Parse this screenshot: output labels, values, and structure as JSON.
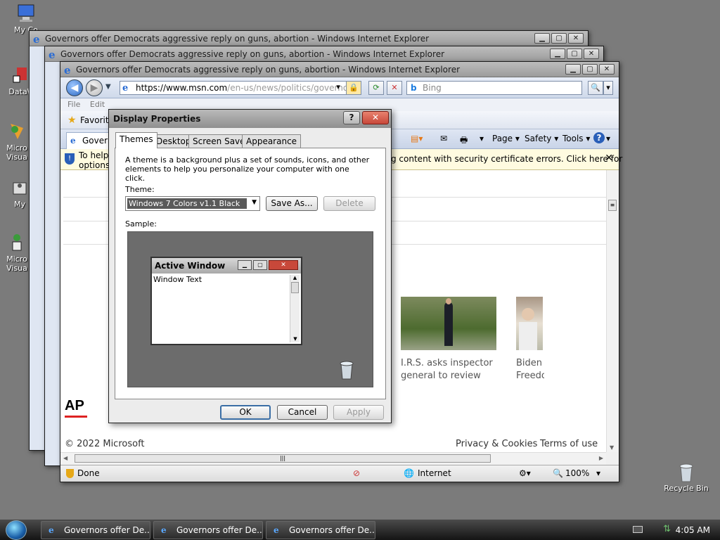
{
  "desktop": {
    "icons": [
      {
        "label": "My Co"
      },
      {
        "label": "DataW"
      },
      {
        "label": "Micro Visua"
      },
      {
        "label": "My"
      },
      {
        "label": "Micro Visua"
      }
    ],
    "recycle_bin": "Recycle Bin"
  },
  "ie": {
    "window_title": "Governors offer Democrats aggressive reply on guns, abortion - Windows Internet Explorer",
    "address_prefix": "https://",
    "address_host": "www.msn.com",
    "address_path": "/en-us/news/politics/governors",
    "search_placeholder": "Bing",
    "menu": [
      "File",
      "Edit"
    ],
    "favorites_label": "Favorites",
    "tab_label": "Governors offer Democrats...",
    "tab_short": "Govern",
    "commands": [
      "Page",
      "Safety",
      "Tools"
    ],
    "info_left": "To help",
    "info_left2": "options.",
    "info_text": "g content with security certificate errors. Click here for",
    "news": [
      {
        "caption1": "I.R.S. asks inspector",
        "caption2": "general to review"
      },
      {
        "caption1": "Biden a",
        "caption2": "Freedo"
      }
    ],
    "brand_logo": "AP",
    "footer_copyright": "© 2022 Microsoft",
    "footer_privacy": "Privacy & Cookies",
    "footer_terms": "Terms of use",
    "status_text": "Done",
    "zone": "Internet",
    "zoom": "100%"
  },
  "dialog": {
    "title": "Display Properties",
    "help_glyph": "?",
    "tabs": [
      "Themes",
      "Desktop",
      "Screen Saver",
      "Appearance"
    ],
    "description": "A theme is a background plus a set of sounds, icons, and other elements to help you personalize your computer with one click.",
    "theme_label": "Theme:",
    "theme_value": "Windows 7 Colors v1.1 Black",
    "save_as": "Save As...",
    "delete": "Delete",
    "sample_label": "Sample:",
    "active_window_title": "Active Window",
    "window_text": "Window Text",
    "ok": "OK",
    "cancel": "Cancel",
    "apply": "Apply"
  },
  "taskbar": {
    "tasks": [
      "Governors offer De...",
      "Governors offer De...",
      "Governors offer De..."
    ],
    "clock": "4:05 AM"
  },
  "colors": {
    "desktop": "#7b7b7b",
    "taskbar": "#1e1e1e",
    "close_red": "#c8483a"
  }
}
